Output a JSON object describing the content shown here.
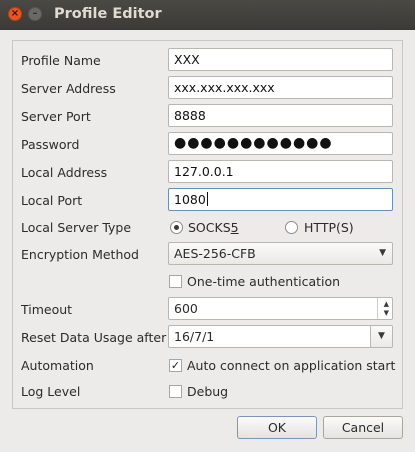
{
  "window": {
    "title": "Profile Editor",
    "close_glyph": "×",
    "minimize_glyph": "–"
  },
  "form": {
    "profile_name": {
      "label": "Profile Name",
      "value": "XXX"
    },
    "server_address": {
      "label": "Server Address",
      "value": "xxx.xxx.xxx.xxx"
    },
    "server_port": {
      "label": "Server Port",
      "value": "8888"
    },
    "password": {
      "label": "Password",
      "value": "●●●●●●●●●●●●"
    },
    "local_address": {
      "label": "Local Address",
      "value": "127.0.0.1"
    },
    "local_port": {
      "label": "Local Port",
      "value": "1080"
    },
    "local_server_type": {
      "label": "Local Server Type",
      "option_socks_prefix": "SOCKS",
      "option_socks_mnemonic": "5",
      "option_http": "HTTP(S)",
      "selected": "SOCKS5"
    },
    "encryption_method": {
      "label": "Encryption Method",
      "value": "AES-256-CFB"
    },
    "one_time_auth": {
      "label": "One-time authentication",
      "checked": false
    },
    "timeout": {
      "label": "Timeout",
      "value": "600"
    },
    "reset_data_usage": {
      "label": "Reset Data Usage after",
      "value": "16/7/1"
    },
    "automation": {
      "label": "Automation",
      "option": "Auto connect on application start",
      "checked": true,
      "check_glyph": "✓"
    },
    "log_level": {
      "label": "Log Level",
      "option": "Debug",
      "checked": false
    }
  },
  "buttons": {
    "ok": "OK",
    "cancel": "Cancel"
  },
  "colors": {
    "accent": "#e95420",
    "titlebar": "#3c3b37"
  }
}
